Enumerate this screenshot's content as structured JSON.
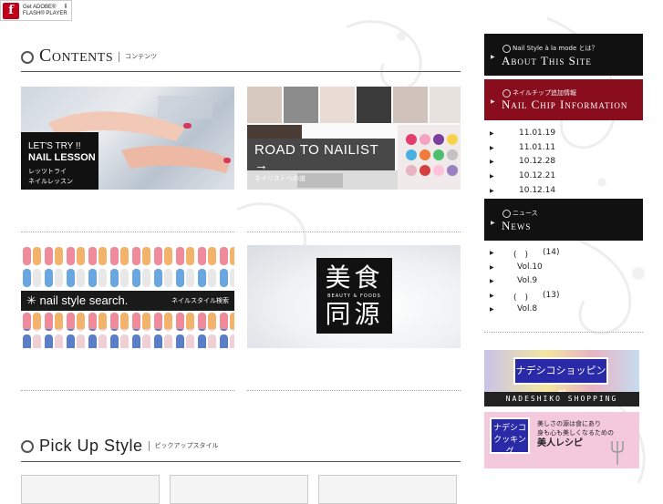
{
  "flash_badge": {
    "line1": "Get ADOBE®",
    "line2": "FLASH® PLAYER"
  },
  "contents": {
    "title": "Contents",
    "subtitle": "コンテンツ"
  },
  "tiles": {
    "lesson": {
      "line1": "LET'S TRY !!",
      "line2": "NAIL LESSON",
      "line3": "レッツトライ",
      "line4": "ネイルレッスン"
    },
    "nailist": {
      "line1": "ROAD TO NAILIST →",
      "line2": "ネイリストへの道"
    },
    "search": {
      "line1": "nail style search.",
      "line2": "ネイルスタイル検索"
    },
    "bishoku": {
      "k1": "美食",
      "en": "BEAUTY & FOODS",
      "k2": "同源"
    }
  },
  "pickup": {
    "title": "Pick Up Style",
    "subtitle": "ピックアップスタイル"
  },
  "sidebar": {
    "about": {
      "small": "Nail Style à la mode とは？",
      "big": "About This Site"
    },
    "chip": {
      "small": "ネイルチップ追加情報",
      "big": "Nail Chip Information",
      "items": [
        "11.01.19",
        "11.01.11",
        "10.12.28",
        "10.12.21",
        "10.12.14"
      ]
    },
    "news": {
      "small": "ニュース",
      "big": "News",
      "items": [
        {
          "text": "(　)",
          "count": "(14)"
        },
        {
          "text": "Vol.10",
          "count": ""
        },
        {
          "text": "Vol.9",
          "count": ""
        },
        {
          "text": "(　)",
          "count": "(13)"
        },
        {
          "text": "Vol.8",
          "count": ""
        }
      ]
    },
    "banner1": {
      "label": "ナデシコショッピング",
      "caption": "NADESHIKO SHOPPING"
    },
    "banner2": {
      "label": "ナデシコ クッキング",
      "text1": "美しさの源は食にあり",
      "text2": "身も心も美しくなるための",
      "text3": "美人レシピ"
    }
  },
  "colors": {
    "chip_header": "#8a0d1e",
    "header_dark": "#111111",
    "banner_blue": "#2a2aa8"
  }
}
